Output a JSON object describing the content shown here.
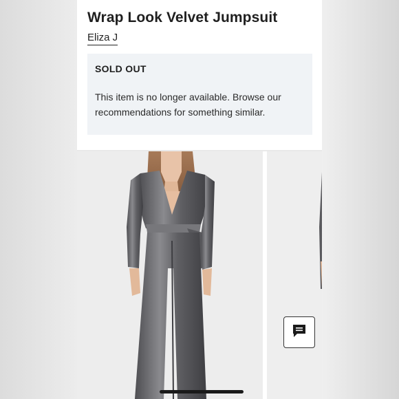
{
  "product": {
    "title": "Wrap Look Velvet Jumpsuit",
    "brand": "Eliza J"
  },
  "availability": {
    "status": "SOLD OUT",
    "message": "This item is no longer available. Browse our recommendations for something similar."
  },
  "gallery": {
    "images": [
      {
        "subject": "model wearing gray velvet wrap jumpsuit, front view"
      },
      {
        "subject": "model wearing gray velvet wrap jumpsuit, side view"
      }
    ]
  },
  "chat": {
    "icon": "chat-icon"
  },
  "colors": {
    "notice_bg": "#f0f3f6",
    "velvet": "#6b6b6e",
    "text": "#1f1f1f"
  }
}
